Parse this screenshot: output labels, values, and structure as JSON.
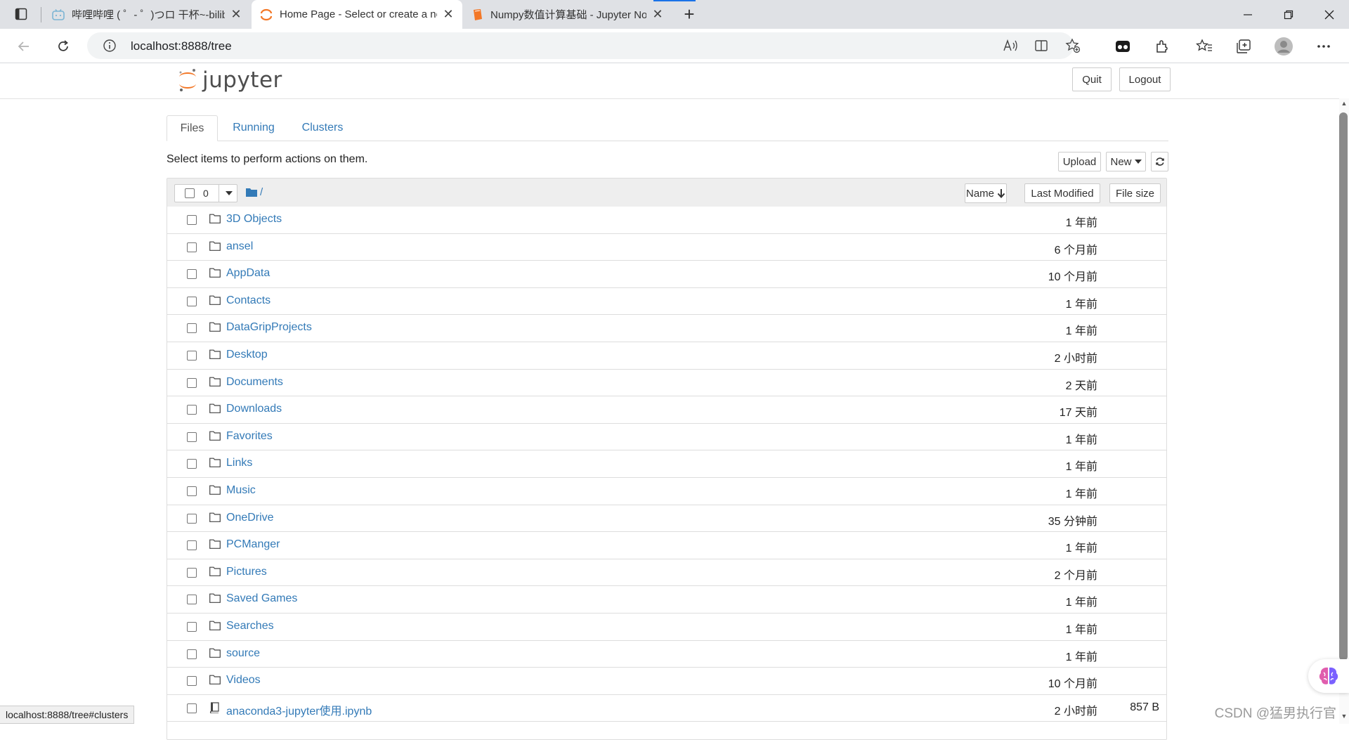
{
  "browser": {
    "tabs": [
      {
        "title": "哔哩哔哩 ( ゜- ゜)つロ 干杯~-bilibili",
        "active": false
      },
      {
        "title": "Home Page - Select or create a notebook",
        "active": true
      },
      {
        "title": "Numpy数值计算基础 - Jupyter Notebook",
        "active": false
      }
    ],
    "new_tab_label": "+",
    "url": "localhost:8888/tree",
    "accent_color": "#1a73e8"
  },
  "jupyter": {
    "logo_text": "jupyter",
    "quit_label": "Quit",
    "logout_label": "Logout",
    "tabs": [
      "Files",
      "Running",
      "Clusters"
    ],
    "hint": "Select items to perform actions on them.",
    "upload_label": "Upload",
    "new_label": "New",
    "selected_count": "0",
    "breadcrumb": "/",
    "columns": {
      "name": "Name",
      "modified": "Last Modified",
      "size": "File size"
    },
    "items": [
      {
        "name": "3D Objects",
        "type": "folder",
        "modified": "1 年前",
        "size": ""
      },
      {
        "name": "ansel",
        "type": "folder",
        "modified": "6 个月前",
        "size": ""
      },
      {
        "name": "AppData",
        "type": "folder",
        "modified": "10 个月前",
        "size": ""
      },
      {
        "name": "Contacts",
        "type": "folder",
        "modified": "1 年前",
        "size": ""
      },
      {
        "name": "DataGripProjects",
        "type": "folder",
        "modified": "1 年前",
        "size": ""
      },
      {
        "name": "Desktop",
        "type": "folder",
        "modified": "2 小时前",
        "size": ""
      },
      {
        "name": "Documents",
        "type": "folder",
        "modified": "2 天前",
        "size": ""
      },
      {
        "name": "Downloads",
        "type": "folder",
        "modified": "17 天前",
        "size": ""
      },
      {
        "name": "Favorites",
        "type": "folder",
        "modified": "1 年前",
        "size": ""
      },
      {
        "name": "Links",
        "type": "folder",
        "modified": "1 年前",
        "size": ""
      },
      {
        "name": "Music",
        "type": "folder",
        "modified": "1 年前",
        "size": ""
      },
      {
        "name": "OneDrive",
        "type": "folder",
        "modified": "35 分钟前",
        "size": ""
      },
      {
        "name": "PCManger",
        "type": "folder",
        "modified": "1 年前",
        "size": ""
      },
      {
        "name": "Pictures",
        "type": "folder",
        "modified": "2 个月前",
        "size": ""
      },
      {
        "name": "Saved Games",
        "type": "folder",
        "modified": "1 年前",
        "size": ""
      },
      {
        "name": "Searches",
        "type": "folder",
        "modified": "1 年前",
        "size": ""
      },
      {
        "name": "source",
        "type": "folder",
        "modified": "1 年前",
        "size": ""
      },
      {
        "name": "Videos",
        "type": "folder",
        "modified": "10 个月前",
        "size": ""
      },
      {
        "name": "anaconda3-jupyter使用.ipynb",
        "type": "notebook",
        "modified": "2 小时前",
        "size": "857 B"
      }
    ],
    "link_color": "#337ab7",
    "brand_color": "#f37726"
  },
  "status_url": "localhost:8888/tree#clusters",
  "watermark": "CSDN @猛男执行官"
}
